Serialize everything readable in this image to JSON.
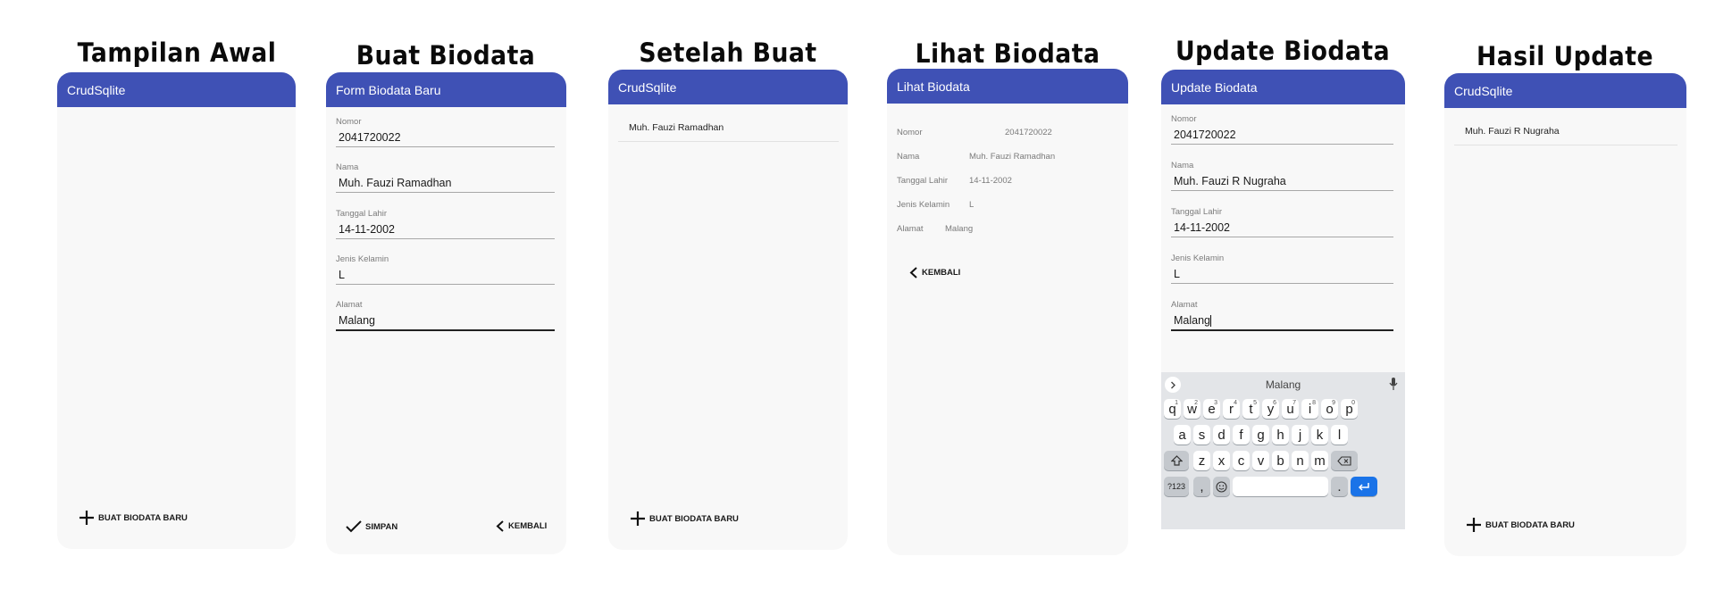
{
  "captions": [
    "Tampilan Awal",
    "Buat Biodata",
    "Setelah Buat",
    "Lihat Biodata",
    "Update Biodata",
    "Hasil Update"
  ],
  "screen1": {
    "title": "CrudSqlite",
    "fab_label": "BUAT BIODATA BARU"
  },
  "screen2": {
    "title": "Form Biodata Baru",
    "fields": [
      {
        "label": "Nomor",
        "value": "2041720022"
      },
      {
        "label": "Nama",
        "value": "Muh. Fauzi Ramadhan"
      },
      {
        "label": "Tanggal Lahir",
        "value": "14-11-2002"
      },
      {
        "label": "Jenis Kelamin",
        "value": "L"
      },
      {
        "label": "Alamat",
        "value": "Malang"
      }
    ],
    "save_label": "SIMPAN",
    "back_label": "KEMBALI"
  },
  "screen3": {
    "title": "CrudSqlite",
    "items": [
      "Muh. Fauzi Ramadhan"
    ],
    "fab_label": "BUAT BIODATA BARU"
  },
  "screen4": {
    "title": "Lihat Biodata",
    "rows": [
      {
        "label": "Nomor",
        "value": "2041720022"
      },
      {
        "label": "Nama",
        "value": "Muh. Fauzi Ramadhan"
      },
      {
        "label": "Tanggal Lahir",
        "value": "14-11-2002"
      },
      {
        "label": "Jenis Kelamin",
        "value": "L"
      },
      {
        "label": "Alamat",
        "value": "Malang"
      }
    ],
    "back_label": "KEMBALI"
  },
  "screen5": {
    "title": "Update Biodata",
    "fields": [
      {
        "label": "Nomor",
        "value": "2041720022"
      },
      {
        "label": "Nama",
        "value": "Muh. Fauzi R Nugraha"
      },
      {
        "label": "Tanggal Lahir",
        "value": "14-11-2002"
      },
      {
        "label": "Jenis Kelamin",
        "value": "L"
      },
      {
        "label": "Alamat",
        "value": "Malang"
      }
    ],
    "keyboard": {
      "suggestion": "Malang",
      "row1": [
        "q",
        "w",
        "e",
        "r",
        "t",
        "y",
        "u",
        "i",
        "o",
        "p"
      ],
      "row1_hints": [
        "1",
        "2",
        "3",
        "4",
        "5",
        "6",
        "7",
        "8",
        "9",
        "0"
      ],
      "row2": [
        "a",
        "s",
        "d",
        "f",
        "g",
        "h",
        "j",
        "k",
        "l"
      ],
      "row3": [
        "z",
        "x",
        "c",
        "v",
        "b",
        "n",
        "m"
      ],
      "symbols_label": "?123",
      "comma": ",",
      "period": "."
    }
  },
  "screen6": {
    "title": "CrudSqlite",
    "items": [
      "Muh. Fauzi R Nugraha"
    ],
    "fab_label": "BUAT BIODATA BARU"
  },
  "colors": {
    "appbar": "#3f51b5",
    "enter_key": "#1a73e8",
    "background": "#f8f8f8"
  }
}
